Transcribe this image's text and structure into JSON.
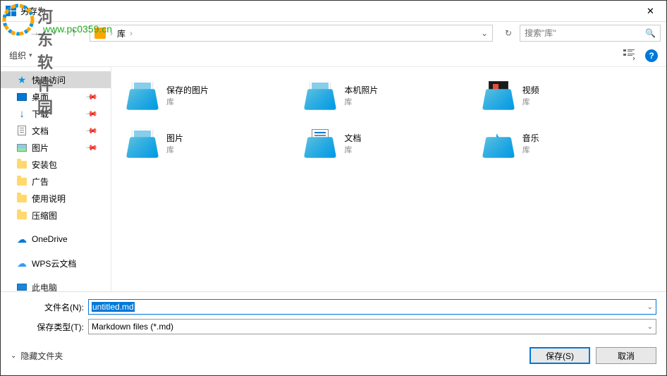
{
  "window": {
    "title": "另存为"
  },
  "watermark": {
    "text": "河东软件园",
    "url": "www.pc0359.cn"
  },
  "nav": {
    "location": "库",
    "search_placeholder": "搜索\"库\"",
    "refresh_tip": "↻"
  },
  "toolbar": {
    "organize": "组织",
    "new_folder": "▾"
  },
  "sidebar": {
    "items": [
      {
        "label": "快速访问",
        "icon": "star",
        "selected": true
      },
      {
        "label": "桌面",
        "icon": "desktop",
        "pinned": true
      },
      {
        "label": "下载",
        "icon": "download",
        "pinned": true
      },
      {
        "label": "文档",
        "icon": "doc",
        "pinned": true
      },
      {
        "label": "图片",
        "icon": "pic",
        "pinned": true
      },
      {
        "label": "安装包",
        "icon": "folder"
      },
      {
        "label": "广告",
        "icon": "folder"
      },
      {
        "label": "使用说明",
        "icon": "folder"
      },
      {
        "label": "压缩图",
        "icon": "folder"
      },
      {
        "label": "OneDrive",
        "icon": "onedrive",
        "spacer": true
      },
      {
        "label": "WPS云文档",
        "icon": "wps",
        "spacer": true
      },
      {
        "label": "此电脑",
        "icon": "pc",
        "spacer": true,
        "partial": true
      }
    ]
  },
  "content": {
    "sub": "库",
    "items": [
      {
        "name": "保存的图片",
        "type": "pic"
      },
      {
        "name": "本机照片",
        "type": "pic"
      },
      {
        "name": "视频",
        "type": "video"
      },
      {
        "name": "图片",
        "type": "pic"
      },
      {
        "name": "文档",
        "type": "doc"
      },
      {
        "name": "音乐",
        "type": "music"
      }
    ]
  },
  "form": {
    "filename_label": "文件名(N):",
    "filename_value": "untitled.md",
    "filetype_label": "保存类型(T):",
    "filetype_value": "Markdown files (*.md)"
  },
  "actions": {
    "hide_folders": "隐藏文件夹",
    "save": "保存(S)",
    "cancel": "取消"
  }
}
